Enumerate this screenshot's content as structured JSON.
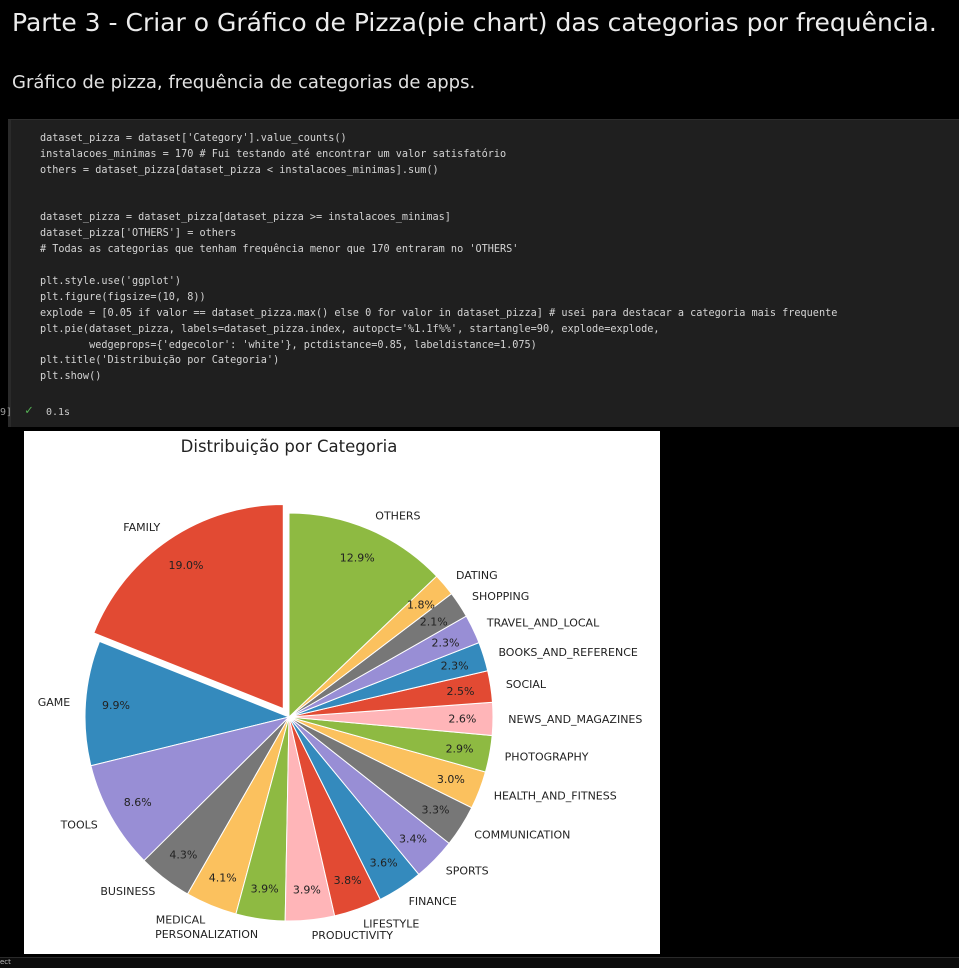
{
  "notebook": {
    "heading": "Parte 3 - Criar o Gráfico de Pizza(pie chart) das categorias por frequência.",
    "subheading": "Gráfico de pizza, frequência de categorias de apps.",
    "code_lines": [
      "dataset_pizza = dataset['Category'].value_counts()",
      "instalacoes_minimas = 170 # Fui testando até encontrar um valor satisfatório",
      "others = dataset_pizza[dataset_pizza < instalacoes_minimas].sum()",
      "",
      "",
      "dataset_pizza = dataset_pizza[dataset_pizza >= instalacoes_minimas]",
      "dataset_pizza['OTHERS'] = others",
      "# Todas as categorias que tenham frequência menor que 170 entraram no 'OTHERS'",
      "",
      "plt.style.use('ggplot')",
      "plt.figure(figsize=(10, 8))",
      "explode = [0.05 if valor == dataset_pizza.max() else 0 for valor in dataset_pizza] # usei para destacar a categoria mais frequente",
      "plt.pie(dataset_pizza, labels=dataset_pizza.index, autopct='%1.1f%%', startangle=90, explode=explode,",
      "        wedgeprops={'edgecolor': 'white'}, pctdistance=0.85, labeldistance=1.075)",
      "plt.title('Distribuição por Categoria')",
      "plt.show()"
    ],
    "exec_count": "9]",
    "exec_time": "0.1s",
    "status_bar_text": "ect"
  },
  "colors": {
    "accent_check": "#54b054",
    "palette": [
      "#E24A33",
      "#348ABD",
      "#988ED5",
      "#777777",
      "#FBC15E",
      "#8EBA42",
      "#FFB5B8"
    ]
  },
  "chart_data": {
    "type": "pie",
    "title": "Distribuição por Categoria",
    "start_angle": 90,
    "direction": "counterclockwise",
    "slices": [
      {
        "label": "FAMILY",
        "value": 19.0,
        "pct": "19.0%",
        "color": "#E24A33",
        "explode": true
      },
      {
        "label": "GAME",
        "value": 9.9,
        "pct": "9.9%",
        "color": "#348ABD",
        "explode": false
      },
      {
        "label": "TOOLS",
        "value": 8.6,
        "pct": "8.6%",
        "color": "#988ED5",
        "explode": false
      },
      {
        "label": "BUSINESS",
        "value": 4.3,
        "pct": "4.3%",
        "color": "#777777",
        "explode": false
      },
      {
        "label": "MEDICAL",
        "value": 4.1,
        "pct": "4.1%",
        "color": "#FBC15E",
        "explode": false
      },
      {
        "label": "PERSONALIZATION",
        "value": 3.9,
        "pct": "3.9%",
        "color": "#8EBA42",
        "explode": false
      },
      {
        "label": "PRODUCTIVITY",
        "value": 3.9,
        "pct": "3.9%",
        "color": "#FFB5B8",
        "explode": false
      },
      {
        "label": "LIFESTYLE",
        "value": 3.8,
        "pct": "3.8%",
        "color": "#E24A33",
        "explode": false
      },
      {
        "label": "FINANCE",
        "value": 3.6,
        "pct": "3.6%",
        "color": "#348ABD",
        "explode": false
      },
      {
        "label": "SPORTS",
        "value": 3.4,
        "pct": "3.4%",
        "color": "#988ED5",
        "explode": false
      },
      {
        "label": "COMMUNICATION",
        "value": 3.3,
        "pct": "3.3%",
        "color": "#777777",
        "explode": false
      },
      {
        "label": "HEALTH_AND_FITNESS",
        "value": 3.0,
        "pct": "3.0%",
        "color": "#FBC15E",
        "explode": false
      },
      {
        "label": "PHOTOGRAPHY",
        "value": 2.9,
        "pct": "2.9%",
        "color": "#8EBA42",
        "explode": false
      },
      {
        "label": "NEWS_AND_MAGAZINES",
        "value": 2.6,
        "pct": "2.6%",
        "color": "#FFB5B8",
        "explode": false
      },
      {
        "label": "SOCIAL",
        "value": 2.5,
        "pct": "2.5%",
        "color": "#E24A33",
        "explode": false
      },
      {
        "label": "BOOKS_AND_REFERENCE",
        "value": 2.3,
        "pct": "2.3%",
        "color": "#348ABD",
        "explode": false
      },
      {
        "label": "TRAVEL_AND_LOCAL",
        "value": 2.3,
        "pct": "2.3%",
        "color": "#988ED5",
        "explode": false
      },
      {
        "label": "SHOPPING",
        "value": 2.1,
        "pct": "2.1%",
        "color": "#777777",
        "explode": false
      },
      {
        "label": "DATING",
        "value": 1.8,
        "pct": "1.8%",
        "color": "#FBC15E",
        "explode": false
      },
      {
        "label": "OTHERS",
        "value": 12.9,
        "pct": "12.9%",
        "color": "#8EBA42",
        "explode": false
      }
    ]
  }
}
